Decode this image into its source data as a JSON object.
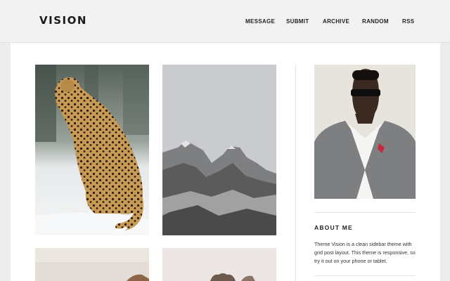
{
  "header": {
    "logo": "VISION",
    "nav": [
      "MESSAGE",
      "SUBMIT",
      "ARCHIVE",
      "RANDOM",
      "RSS"
    ]
  },
  "posts": [
    {
      "subject": "cheetah-photo"
    },
    {
      "subject": "mountains-photo"
    },
    {
      "subject": "fox-photo"
    },
    {
      "subject": "wolf-photo"
    }
  ],
  "sidebar": {
    "about_title": "ABOUT ME",
    "about_text": "Theme Vision is a clean sidebar theme with grid post layout. This theme is responsive, so try it out on your phone or tablet."
  },
  "colors": {
    "header_bg": "#f2f2f2",
    "page_bg": "#ececec",
    "content_bg": "#ffffff",
    "text": "#222222"
  }
}
